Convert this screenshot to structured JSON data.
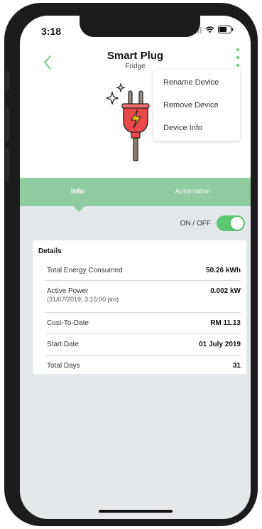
{
  "status_bar": {
    "time": "3:18"
  },
  "header": {
    "title": "Smart Plug",
    "subtitle": "Fridge"
  },
  "menu": {
    "items": [
      "Rename Device",
      "Remove Device",
      "Device Info"
    ]
  },
  "tabs": [
    {
      "label": "Info"
    },
    {
      "label": "Automation"
    }
  ],
  "toggle": {
    "label": "ON / OFF",
    "state": "on"
  },
  "details": {
    "title": "Details",
    "rows": [
      {
        "label": "Total Energy Consumed",
        "value": "50.26 kWh"
      },
      {
        "label": "Active Power",
        "sublabel": "(31/07/2019, 3:15:00 pm)",
        "value": "0.002 kW"
      },
      {
        "label": "Cost-To-Date",
        "value": "RM 11.13"
      },
      {
        "label": "Start Date",
        "value": "01 July 2019"
      },
      {
        "label": "Total Days",
        "value": "31"
      }
    ]
  },
  "colors": {
    "accent_green": "#8fcc9f",
    "toggle_green": "#5ac773",
    "plug_red": "#e84a4a",
    "bolt_yellow": "#f5c518"
  }
}
